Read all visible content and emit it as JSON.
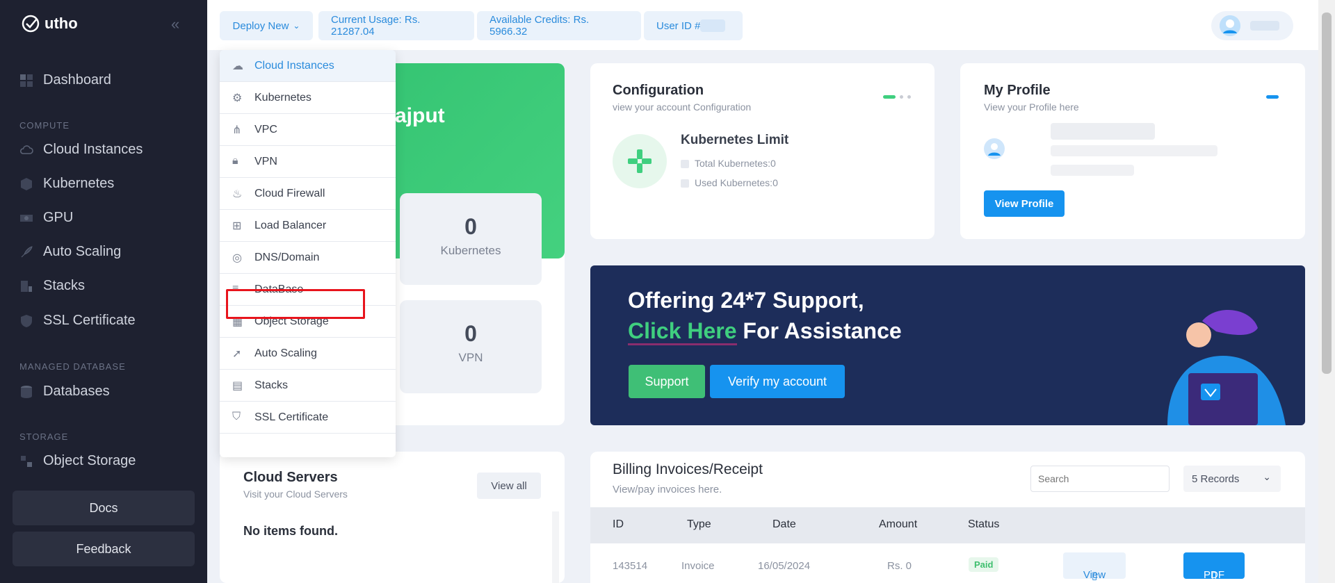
{
  "sidebar": {
    "logo": "utho",
    "dashboard": "Dashboard",
    "sections": {
      "compute": "COMPUTE",
      "managed_db": "MANAGED DATABASE",
      "storage": "STORAGE"
    },
    "items": [
      "Cloud Instances",
      "Kubernetes",
      "GPU",
      "Auto Scaling",
      "Stacks",
      "SSL Certificate"
    ],
    "databases": "Databases",
    "object_storage": "Object Storage",
    "docs": "Docs",
    "feedback": "Feedback"
  },
  "topbar": {
    "deploy": "Deploy New",
    "usage": "Current Usage: Rs. 21287.04",
    "credits": "Available Credits: Rs. 5966.32",
    "user_id": "User ID # "
  },
  "dropdown": {
    "items": [
      "Cloud Instances",
      "Kubernetes",
      "VPC",
      "VPN",
      "Cloud Firewall",
      "Load Balancer",
      "DNS/Domain",
      "DataBase",
      "Object Storage",
      "Auto Scaling",
      "Stacks",
      "SSL Certificate"
    ]
  },
  "welcome": {
    "name_fragment": "ajput"
  },
  "stats": [
    {
      "value": "0",
      "label": "Kubernetes"
    },
    {
      "value": "0",
      "label": "VPN"
    }
  ],
  "configuration": {
    "title": "Configuration",
    "subtitle": "view your account Configuration",
    "limit_title": "Kubernetes Limit",
    "total": "Total Kubernetes:0",
    "used": "Used Kubernetes:0"
  },
  "profile": {
    "title": "My Profile",
    "subtitle": "View your Profile here",
    "button": "View Profile"
  },
  "banner": {
    "line1": "Offering 24*7 Support,",
    "link": "Click Here",
    "line2_rest": " For Assistance",
    "support": "Support",
    "verify": "Verify my account"
  },
  "servers": {
    "title": "Cloud Servers",
    "subtitle": "Visit your Cloud Servers",
    "view_all": "View all",
    "empty": "No items found."
  },
  "billing": {
    "title": "Billing Invoices/Receipt",
    "subtitle": "View/pay invoices here.",
    "search_placeholder": "Search",
    "records": "5 Records",
    "headers": [
      "ID",
      "Type",
      "Date",
      "Amount",
      "Status"
    ],
    "rows": [
      {
        "id": "143514",
        "type": "Invoice",
        "date": "16/05/2024",
        "amount": "Rs. 0",
        "status": "Paid",
        "view": "View",
        "pdf": "PDF"
      }
    ]
  },
  "colors": {
    "accent": "#1693ef",
    "green": "#3fcf7f",
    "sidebar": "#1e2130",
    "highlight": "#e8141c"
  }
}
